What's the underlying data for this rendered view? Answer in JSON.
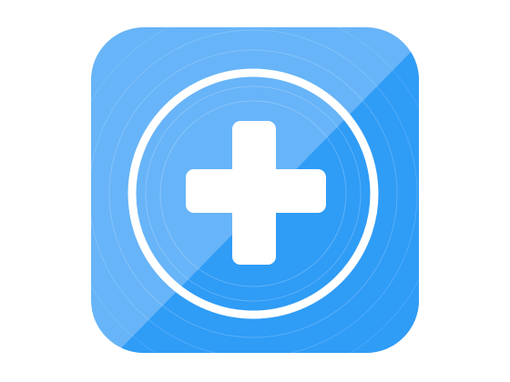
{
  "icon": {
    "name": "plus-app-icon",
    "symbol": "plus-icon",
    "colors": {
      "light_blue": "#6DB8FA",
      "dark_blue": "#2E9BF6",
      "glyph": "#FFFFFF"
    }
  }
}
